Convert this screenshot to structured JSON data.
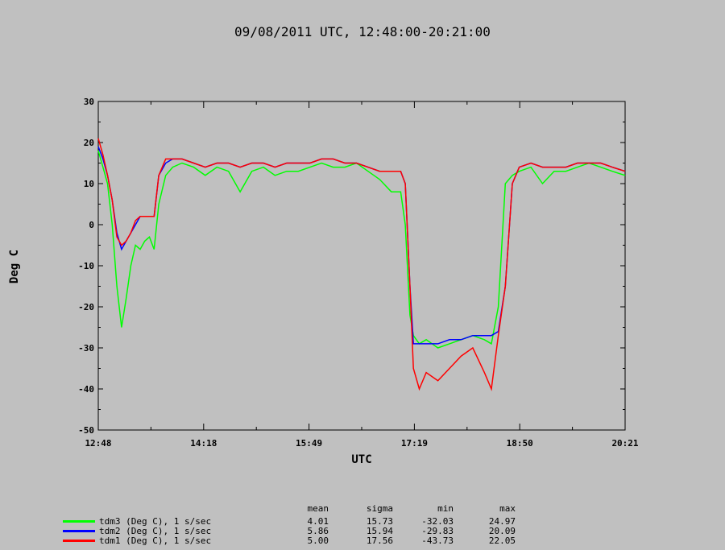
{
  "chart_data": {
    "type": "line",
    "title": "09/08/2011  UTC, 12:48:00-20:21:00",
    "xlabel": "UTC",
    "ylabel": "Deg C",
    "x_ticks": [
      "12:48",
      "14:18",
      "15:49",
      "17:19",
      "18:50",
      "20:21"
    ],
    "y_ticks": [
      30,
      20,
      10,
      0,
      -10,
      -20,
      -30,
      -40,
      -50
    ],
    "ylim": [
      -50,
      30
    ],
    "xlim": [
      "12:48",
      "20:21"
    ],
    "grid": false,
    "legend_position": "bottom-left",
    "stats_headers": [
      "mean",
      "sigma",
      "min",
      "max"
    ],
    "series": [
      {
        "name": "tdm3 (Deg C), 1 s/sec",
        "color": "#00ff00",
        "stats": [
          "4.01",
          "15.73",
          "-32.03",
          "24.97"
        ],
        "x": [
          "12:48",
          "12:52",
          "12:56",
          "13:00",
          "13:04",
          "13:08",
          "13:12",
          "13:16",
          "13:20",
          "13:24",
          "13:28",
          "13:32",
          "13:36",
          "13:40",
          "13:46",
          "13:52",
          "14:00",
          "14:10",
          "14:20",
          "14:30",
          "14:40",
          "14:50",
          "15:00",
          "15:10",
          "15:20",
          "15:30",
          "15:40",
          "15:50",
          "16:00",
          "16:10",
          "16:20",
          "16:30",
          "16:40",
          "16:50",
          "17:00",
          "17:08",
          "17:12",
          "17:16",
          "17:19",
          "17:24",
          "17:30",
          "17:40",
          "17:50",
          "18:00",
          "18:10",
          "18:20",
          "18:26",
          "18:32",
          "18:38",
          "18:44",
          "18:50",
          "19:00",
          "19:10",
          "19:20",
          "19:30",
          "19:40",
          "19:50",
          "20:00",
          "20:10",
          "20:21"
        ],
        "y": [
          18,
          14,
          10,
          0,
          -15,
          -25,
          -18,
          -10,
          -5,
          -6,
          -4,
          -3,
          -6,
          5,
          12,
          14,
          15,
          14,
          12,
          14,
          13,
          8,
          13,
          14,
          12,
          13,
          13,
          14,
          15,
          14,
          14,
          15,
          13,
          11,
          8,
          8,
          0,
          -22,
          -27,
          -29,
          -28,
          -30,
          -29,
          -28,
          -27,
          -28,
          -29,
          -20,
          10,
          12,
          13,
          14,
          10,
          13,
          13,
          14,
          15,
          14,
          13,
          12
        ]
      },
      {
        "name": "tdm2 (Deg C), 1 s/sec",
        "color": "#0000ff",
        "stats": [
          "5.86",
          "15.94",
          "-29.83",
          "20.09"
        ],
        "x": [
          "12:48",
          "12:52",
          "12:56",
          "13:00",
          "13:04",
          "13:08",
          "13:12",
          "13:16",
          "13:20",
          "13:24",
          "13:28",
          "13:32",
          "13:36",
          "13:40",
          "13:46",
          "13:52",
          "14:00",
          "14:10",
          "14:20",
          "14:30",
          "14:40",
          "14:50",
          "15:00",
          "15:10",
          "15:20",
          "15:30",
          "15:40",
          "15:50",
          "16:00",
          "16:10",
          "16:20",
          "16:30",
          "16:40",
          "16:50",
          "17:00",
          "17:08",
          "17:12",
          "17:16",
          "17:19",
          "17:24",
          "17:30",
          "17:40",
          "17:50",
          "18:00",
          "18:10",
          "18:20",
          "18:26",
          "18:32",
          "18:38",
          "18:44",
          "18:50",
          "19:00",
          "19:10",
          "19:20",
          "19:30",
          "19:40",
          "19:50",
          "20:00",
          "20:10",
          "20:21"
        ],
        "y": [
          19,
          16,
          12,
          6,
          -2,
          -6,
          -4,
          -2,
          0,
          2,
          2,
          2,
          2,
          12,
          15,
          16,
          16,
          15,
          14,
          15,
          15,
          14,
          15,
          15,
          14,
          15,
          15,
          15,
          16,
          16,
          15,
          15,
          14,
          13,
          13,
          13,
          10,
          -15,
          -29,
          -29,
          -29,
          -29,
          -28,
          -28,
          -27,
          -27,
          -27,
          -26,
          -15,
          10,
          14,
          15,
          14,
          14,
          14,
          15,
          15,
          15,
          14,
          13
        ]
      },
      {
        "name": "tdm1 (Deg C), 1 s/sec",
        "color": "#ff0000",
        "stats": [
          "5.00",
          "17.56",
          "-43.73",
          "22.05"
        ],
        "x": [
          "12:48",
          "12:52",
          "12:56",
          "13:00",
          "13:04",
          "13:08",
          "13:12",
          "13:16",
          "13:20",
          "13:24",
          "13:28",
          "13:32",
          "13:36",
          "13:40",
          "13:46",
          "13:52",
          "14:00",
          "14:10",
          "14:20",
          "14:30",
          "14:40",
          "14:50",
          "15:00",
          "15:10",
          "15:20",
          "15:30",
          "15:40",
          "15:50",
          "16:00",
          "16:10",
          "16:20",
          "16:30",
          "16:40",
          "16:50",
          "17:00",
          "17:08",
          "17:12",
          "17:16",
          "17:19",
          "17:24",
          "17:30",
          "17:40",
          "17:50",
          "18:00",
          "18:10",
          "18:20",
          "18:26",
          "18:32",
          "18:38",
          "18:44",
          "18:50",
          "19:00",
          "19:10",
          "19:20",
          "19:30",
          "19:40",
          "19:50",
          "20:00",
          "20:10",
          "20:21"
        ],
        "y": [
          21,
          17,
          12,
          6,
          -3,
          -5,
          -4,
          -2,
          1,
          2,
          2,
          2,
          2,
          12,
          16,
          16,
          16,
          15,
          14,
          15,
          15,
          14,
          15,
          15,
          14,
          15,
          15,
          15,
          16,
          16,
          15,
          15,
          14,
          13,
          13,
          13,
          10,
          -15,
          -35,
          -40,
          -36,
          -38,
          -35,
          -32,
          -30,
          -36,
          -40,
          -27,
          -15,
          10,
          14,
          15,
          14,
          14,
          14,
          15,
          15,
          15,
          14,
          13
        ]
      }
    ]
  }
}
